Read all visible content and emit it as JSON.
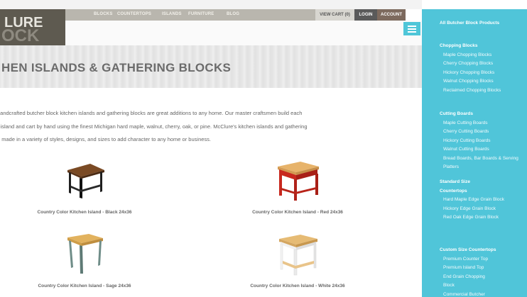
{
  "logo": {
    "line1": "LURE",
    "line2": "OCK"
  },
  "nav": {
    "items": [
      "BLOCKS",
      "COUNTERTOPS",
      "ISLANDS",
      "FURNITURE",
      "BLOG"
    ]
  },
  "header": {
    "cart_label": "VIEW CART (0)",
    "login_label": "LOGIN",
    "account_label": "ACCOUNT"
  },
  "hero": {
    "title": "HEN ISLANDS & GATHERING BLOCKS"
  },
  "intro": {
    "line1": "handcrafted butcher block kitchen islands and gathering blocks are great additions to any home. Our master craftsmen build each",
    "line2": "r island and cart by hand using the finest Michigan hard maple, walnut, cherry, oak, or pine. McClure's kitchen islands and gathering",
    "line3": "e made in a variety of styles, designs, and sizes to add character to any home or business."
  },
  "products": [
    {
      "name": "Country Color Kitchen Island - Black 24x36",
      "color": "#1f1f1f",
      "top": "#7a4a24"
    },
    {
      "name": "Country Color Kitchen Island - Red 24x36",
      "color": "#c8281e",
      "top": "#e7b36a"
    },
    {
      "name": "Country Color Kitchen Island - Sage 24x36",
      "color": "#6f8d88",
      "top": "#e2b25e"
    },
    {
      "name": "Country Color Kitchen Island - White 24x36",
      "color": "#f2f2f2",
      "top": "#e6bb74"
    }
  ],
  "sidebar": {
    "all_link": "All Butcher Block Products",
    "groups": [
      {
        "title": "Chopping Blocks",
        "items": [
          "Maple Chopping Blocks",
          "Cherry Chopping Blocks",
          "Hickory Chopping Blocks",
          "Walnut Chopping Blocks",
          "Reclaimed Chopping Blocks"
        ]
      },
      {
        "title": "Cutting Boards",
        "items": [
          "Maple Cutting Boards",
          "Cherry Cutting Boards",
          "Hickory Cutting Boards",
          "Walnut Cutting Boards",
          "Bread Boards, Bar Boards & Serving Platters"
        ]
      },
      {
        "title": "Standard Size Countertops",
        "items": [
          "Hard Maple Edge Grain Block",
          "Hickory Edge Grain Block",
          "Red Oak Edge Grain Block"
        ]
      },
      {
        "title": "Custom Size Countertops",
        "items": [
          "Premium Counter Top",
          "Premium Island Top",
          "End Grain Chopping Block",
          "Commercial Butcher"
        ]
      }
    ]
  },
  "colors": {
    "accent": "#50c5d9",
    "nav_bg": "#b9b6ae",
    "login_bg": "#5a5a5a",
    "account_bg": "#7d6a5e"
  }
}
